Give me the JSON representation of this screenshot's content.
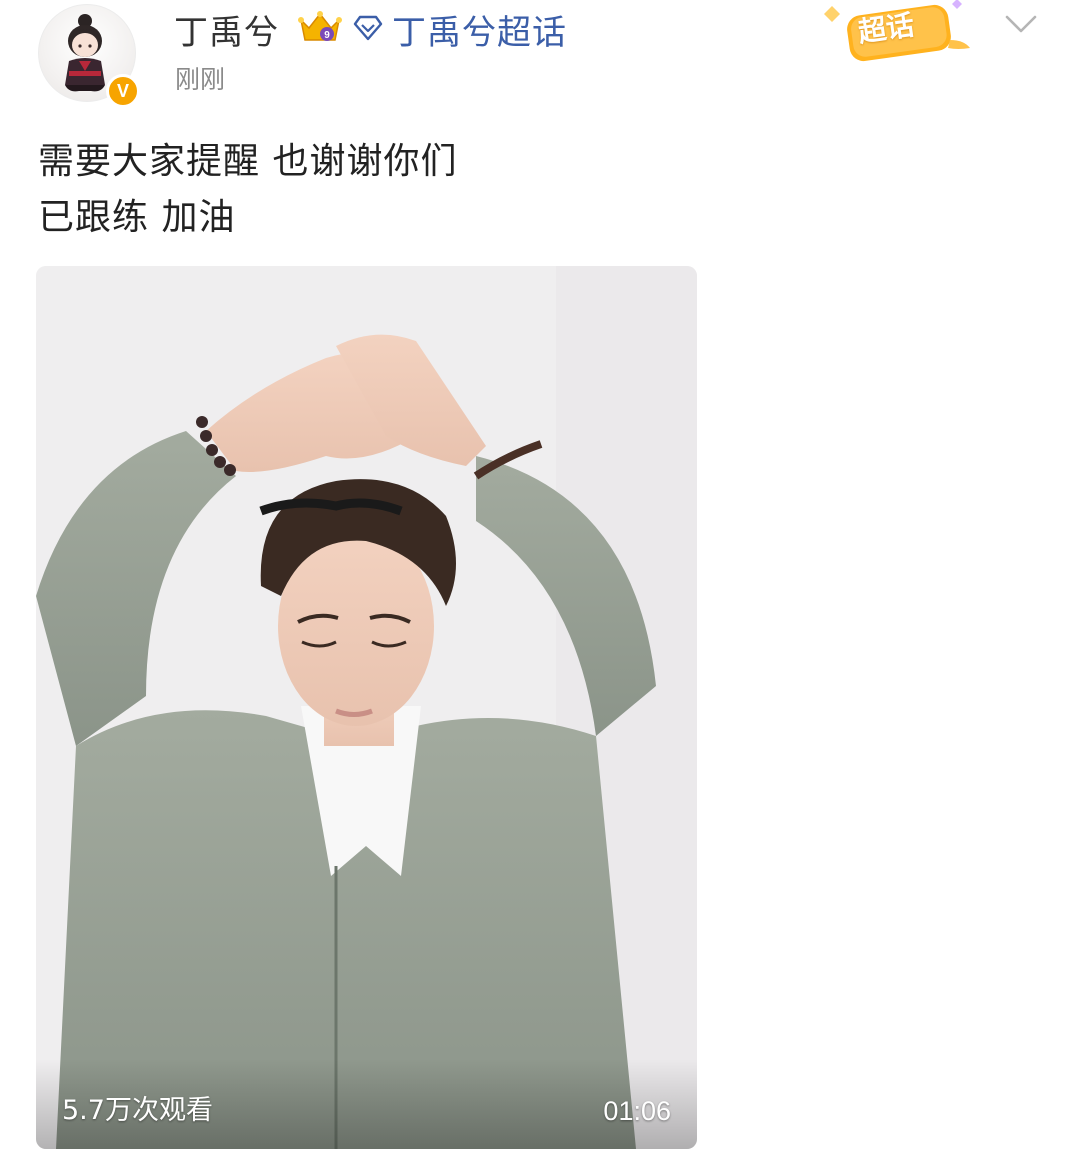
{
  "post": {
    "author": {
      "name": "丁禹兮",
      "verified_mark": "V",
      "avatar_icon": "chibi-avatar-icon"
    },
    "supertopic_link": "丁禹兮超话",
    "timestamp": "刚刚",
    "chaohua_badge": "超话",
    "text_lines": [
      "需要大家提醒 也谢谢你们",
      "已跟练 加油"
    ],
    "video": {
      "view_count": "5.7万次观看",
      "duration": "01:06"
    }
  },
  "colors": {
    "link": "#3b5ea8",
    "name": "#333333",
    "timestamp": "#8a8a8a",
    "badge_orange": "#f7a400",
    "jacket": "#9aa59a"
  }
}
